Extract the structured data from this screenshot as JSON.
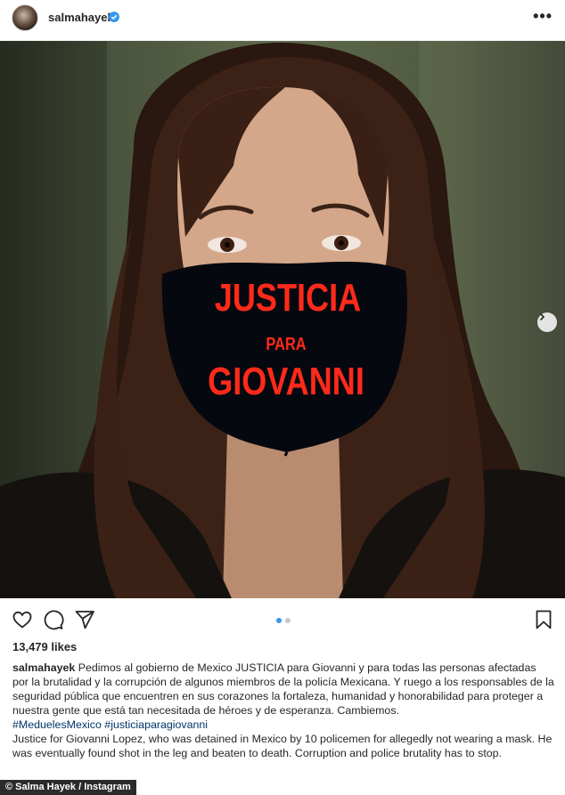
{
  "header": {
    "username": "salmahayek",
    "verified": "verified-badge-icon",
    "more": "•••"
  },
  "photo": {
    "mask_lines": [
      "JUSTICIA",
      "PARA",
      "GIOVANNI"
    ],
    "mask_text_color": "#ff2a1a",
    "carousel_next": "chevron-right-icon"
  },
  "actions": {
    "icons": [
      "heart-icon",
      "comment-icon",
      "share-icon",
      "bookmark-icon"
    ],
    "carousel_dots": {
      "count": 2,
      "active_index": 0
    }
  },
  "likes": "13,479 likes",
  "caption": {
    "username": "salmahayek",
    "text": "Pedimos al gobierno de Mexico JUSTICIA para Giovanni y para todas las personas afectadas por la brutalidad y la corrupción de algunos miembros de la policía Mexicana. Y ruego a los responsables de la seguridad pública que encuentren en sus corazones la fortaleza, humanidad y honorabilidad para proteger a nuestra gente que está tan necesitada de héroes y de esperanza. Cambiemos.",
    "hashtags": "#MeduelesMexico #justiciaparagiovanni",
    "translation": "Justice for Giovanni Lopez, who was detained in Mexico by 10 policemen for allegedly not wearing a mask. He was eventually found shot in the leg and beaten to death. Corruption and police brutality has to stop."
  },
  "credit": "© Salma Hayek / Instagram",
  "colors": {
    "link": "#003569",
    "accent": "#3897f0",
    "verified": "#3897f0"
  }
}
